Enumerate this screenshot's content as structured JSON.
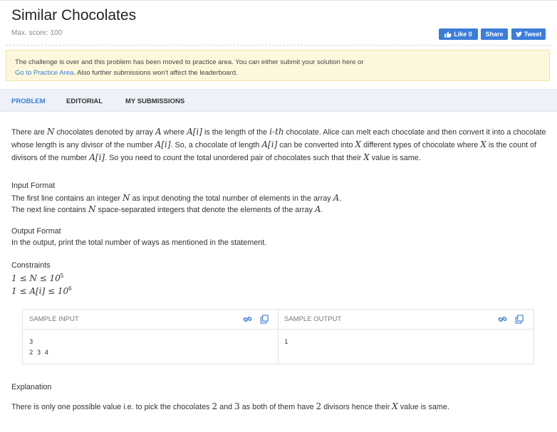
{
  "header": {
    "title": "Similar Chocolates",
    "max_score": "Max. score: 100",
    "like_label": "Like 0",
    "share_label": "Share",
    "tweet_label": "Tweet"
  },
  "notice": {
    "line1": "The challenge is over and this problem has been moved to practice area. You can either submit your solution here or",
    "link_text": "Go to Practice Area",
    "line2_rest": ". Also further submissions won't affect the leaderboard."
  },
  "tabs": [
    {
      "label": "PROBLEM",
      "active": true
    },
    {
      "label": "EDITORIAL",
      "active": false
    },
    {
      "label": "MY SUBMISSIONS",
      "active": false
    }
  ],
  "statement": {
    "p1": "There are",
    "p2": "chocolates denoted by array",
    "p3": "where",
    "p4": "is the length of the",
    "p5": "chocolate. Alice can melt each chocolate and then convert it into a chocolate whose length is any divisor of the number",
    "p6": ". So, a chocolate of length",
    "p7": "can be converted into",
    "p8": "different types of chocolate where",
    "p9": "is the count of divisors of the number",
    "p10": ". So you need to count the total unordered pair of chocolates such that their",
    "p11": "value is same."
  },
  "math": {
    "N": "N",
    "A": "A",
    "Ai": "A[i]",
    "ith": "i-th",
    "X": "X"
  },
  "input_format": {
    "heading": "Input Format",
    "line1_a": "The first line contains an integer",
    "line1_b": "as input denoting the total number of elements in the array",
    "line2_a": "The next line contains",
    "line2_b": "space-separated integers that denote the elements of the array"
  },
  "output_format": {
    "heading": "Output Format",
    "line1": "In the output, print the total number of ways as mentioned in the statement."
  },
  "constraints": {
    "heading": "Constraints",
    "c1": "1 ≤ N ≤ 10",
    "c1_exp": "5",
    "c2": "1 ≤ A[i] ≤ 10",
    "c2_exp": "6"
  },
  "samples": {
    "input_label": "SAMPLE INPUT",
    "output_label": "SAMPLE OUTPUT",
    "input_text": "3\n2 3 4",
    "output_text": "1"
  },
  "explanation": {
    "heading": "Explanation",
    "a": "There is only one possible value i.e. to pick the chocolates",
    "n2": "2",
    "and": "and",
    "n3": "3",
    "b": "as both of them have",
    "c": "divisors hence their",
    "d": "value is same."
  },
  "colors": {
    "accent": "#3b7dd8",
    "notice_bg": "#fdf8dc",
    "tabs_bg": "#eef1f8"
  },
  "icons": [
    "thumbs-up-icon",
    "twitter-bird-icon",
    "link-icon",
    "copy-icon"
  ]
}
